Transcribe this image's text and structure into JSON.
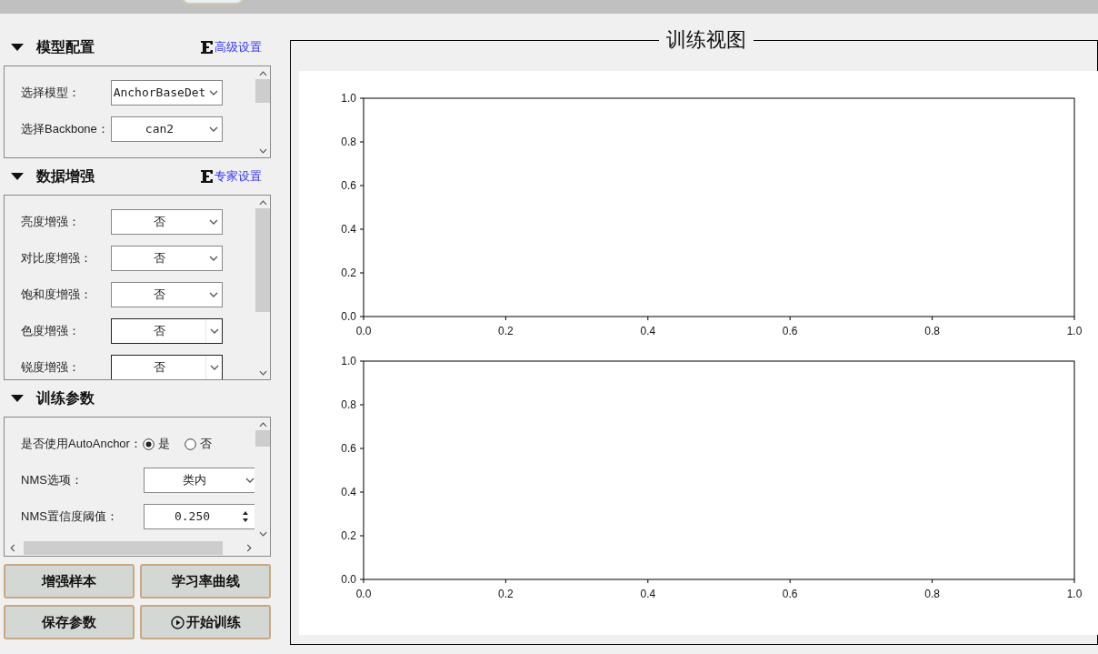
{
  "sections": [
    {
      "title": "模型配置",
      "expanded": true,
      "link": "高级设置",
      "rows": [
        {
          "kind": "combo",
          "label": "选择模型：",
          "value": "AnchorBaseDet",
          "focused": false
        },
        {
          "kind": "combo",
          "label": "选择Backbone：",
          "value": "can2",
          "focused": false
        }
      ]
    },
    {
      "title": "数据增强",
      "expanded": true,
      "link": "专家设置",
      "rows": [
        {
          "kind": "combo",
          "label": "亮度增强：",
          "value": "否",
          "focused": false
        },
        {
          "kind": "combo",
          "label": "对比度增强：",
          "value": "否",
          "focused": false
        },
        {
          "kind": "combo",
          "label": "饱和度增强：",
          "value": "否",
          "focused": false
        },
        {
          "kind": "combo",
          "label": "色度增强：",
          "value": "否",
          "focused": true
        },
        {
          "kind": "combo",
          "label": "锐度增强：",
          "value": "否",
          "focused": true
        }
      ]
    },
    {
      "title": "训练参数",
      "expanded": true,
      "rows": [
        {
          "kind": "radio",
          "label": "是否使用AutoAnchor：",
          "options": [
            {
              "label": "是",
              "selected": true
            },
            {
              "label": "否",
              "selected": false
            }
          ]
        },
        {
          "kind": "combo",
          "label": "NMS选项：",
          "value": "类内",
          "focused": false
        },
        {
          "kind": "spin",
          "label": "NMS置信度阈值：",
          "value": "0.250"
        }
      ]
    }
  ],
  "buttons": [
    {
      "kind": "plain",
      "label": "增强样本"
    },
    {
      "kind": "plain",
      "label": "学习率曲线"
    },
    {
      "kind": "plain",
      "label": "保存参数"
    },
    {
      "kind": "play",
      "label": "开始训练"
    }
  ],
  "view": {
    "title": "训练视图",
    "charts": [
      {
        "chart_data": {
          "type": "line",
          "xlim": [
            0,
            1
          ],
          "ylim": [
            0,
            1
          ],
          "xticks": [
            {
              "value": 0,
              "label": "0.0"
            },
            {
              "value": 0.2,
              "label": "0.2"
            },
            {
              "value": 0.4,
              "label": "0.4"
            },
            {
              "value": 0.6,
              "label": "0.6"
            },
            {
              "value": 0.8,
              "label": "0.8"
            },
            {
              "value": 1,
              "label": "1.0"
            }
          ],
          "yticks": [
            {
              "value": 0,
              "label": "0.0"
            },
            {
              "value": 0.2,
              "label": "0.2"
            },
            {
              "value": 0.4,
              "label": "0.4"
            },
            {
              "value": 0.6,
              "label": "0.6"
            },
            {
              "value": 0.8,
              "label": "0.8"
            },
            {
              "value": 1,
              "label": "1.0"
            }
          ]
        }
      },
      {
        "chart_data": {
          "type": "line",
          "xlim": [
            0,
            1
          ],
          "ylim": [
            0,
            1
          ],
          "xticks": [
            {
              "value": 0,
              "label": "0.0"
            },
            {
              "value": 0.2,
              "label": "0.2"
            },
            {
              "value": 0.4,
              "label": "0.4"
            },
            {
              "value": 0.6,
              "label": "0.6"
            },
            {
              "value": 0.8,
              "label": "0.8"
            },
            {
              "value": 1,
              "label": "1.0"
            }
          ],
          "yticks": [
            {
              "value": 0,
              "label": "0.0"
            },
            {
              "value": 0.2,
              "label": "0.2"
            },
            {
              "value": 0.4,
              "label": "0.4"
            },
            {
              "value": 0.6,
              "label": "0.6"
            },
            {
              "value": 0.8,
              "label": "0.8"
            },
            {
              "value": 1,
              "label": "1.0"
            }
          ]
        }
      }
    ]
  }
}
